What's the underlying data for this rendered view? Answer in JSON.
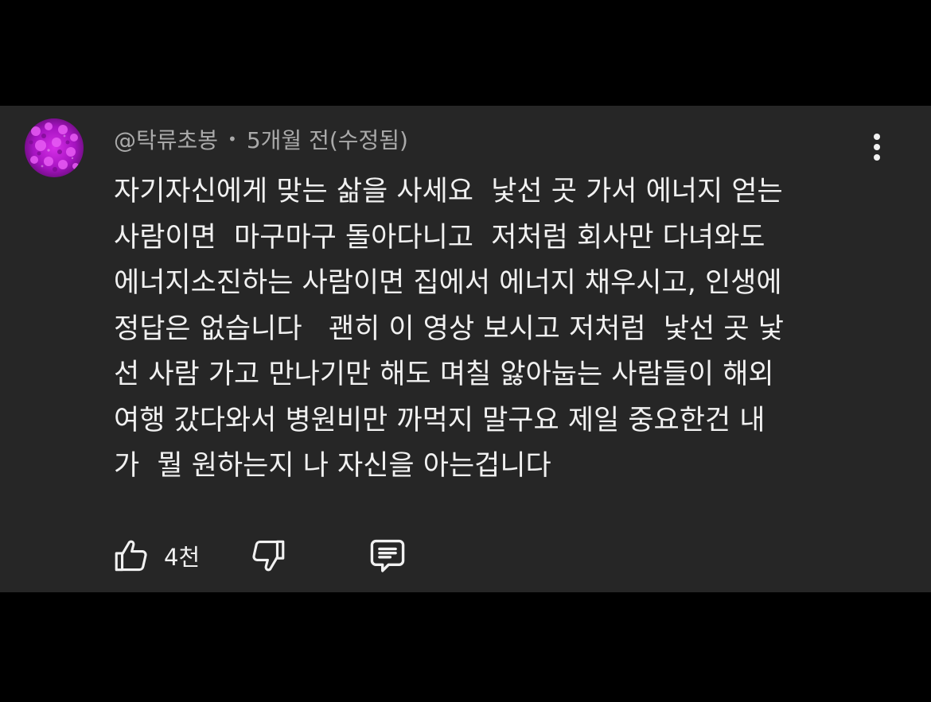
{
  "comment": {
    "author": "@탁류초봉",
    "separator": "•",
    "timestamp": "5개월 전(수정됨)",
    "body_lines": [
      "자기자신에게 맞는 삶을 사세요  낯선 곳 가서 에너지 얻는",
      "사람이면  마구마구 돌아다니고  저처럼 회사만 다녀와도",
      "에너지소진하는 사람이면 집에서 에너지 채우시고, 인생에",
      "정답은 없습니다   괜히 이 영상 보시고 저처럼  낯선 곳 낯",
      "선 사람 가고 만나기만 해도 며칠 앓아눕는 사람들이 해외",
      "여행 갔다와서 병원비만 까먹지 말구요 제일 중요한건 내",
      "가  뭘 원하는지 나 자신을 아는겁니다"
    ],
    "like_count": "4천"
  },
  "icons": {
    "avatar": "flower-avatar",
    "menu": "more-vertical-icon",
    "like": "thumbs-up-icon",
    "dislike": "thumbs-down-icon",
    "reply": "comment-icon"
  },
  "colors": {
    "page_background": "#000000",
    "card_background": "#262626",
    "primary_text": "#f1f1f1",
    "secondary_text": "#aaaaaa",
    "avatar_flower": "#c21bd6"
  }
}
